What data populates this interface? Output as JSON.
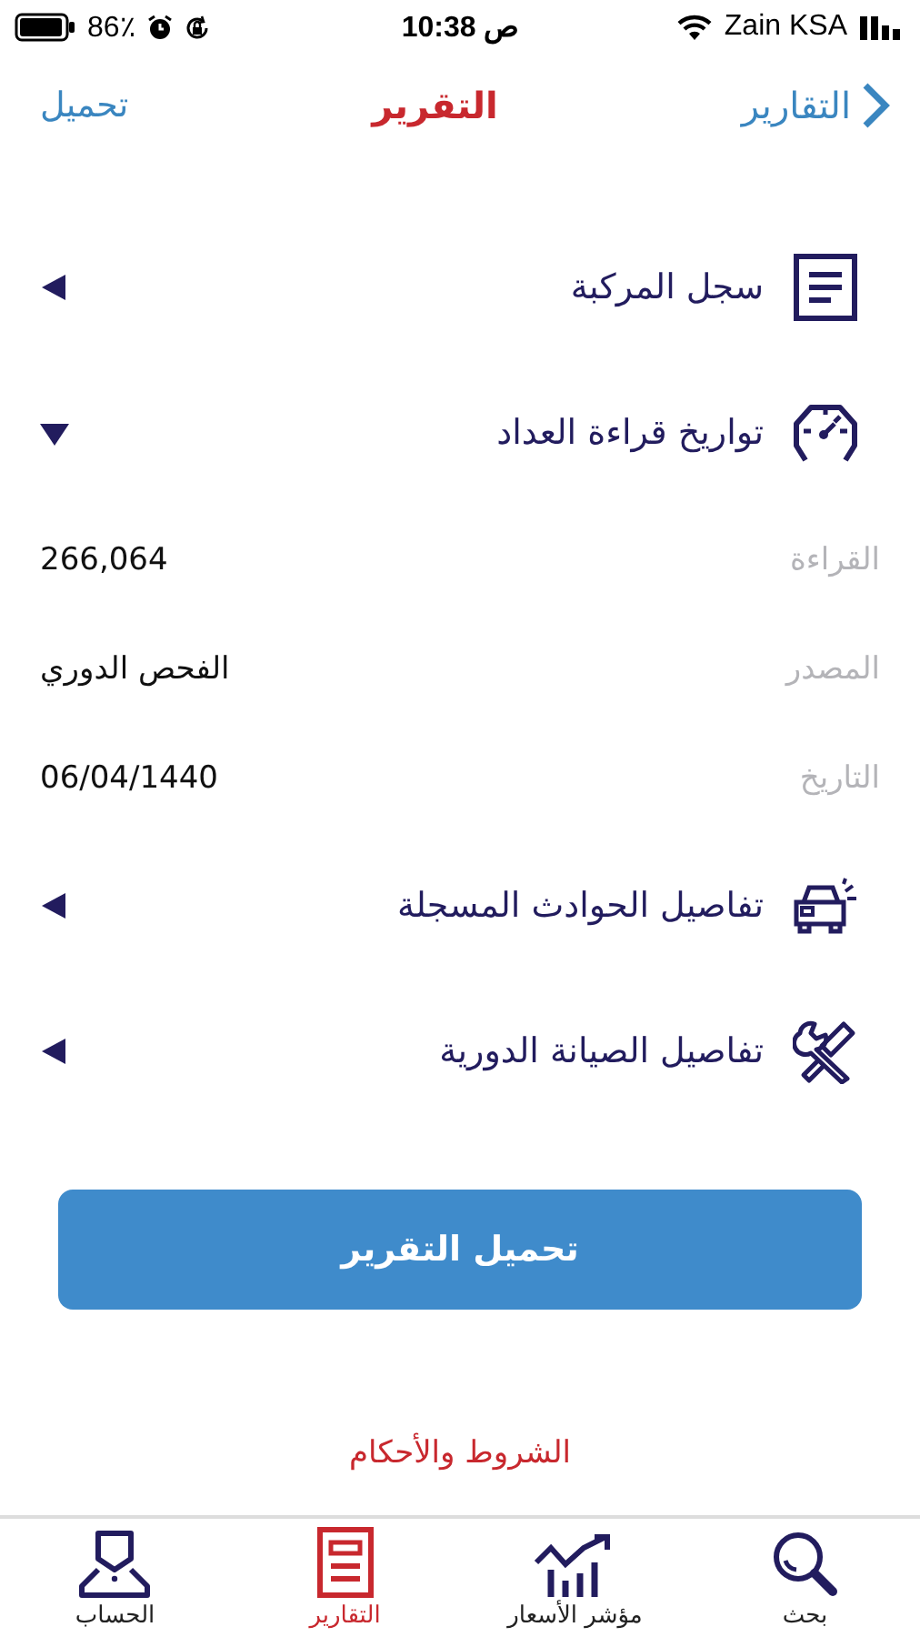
{
  "status_bar": {
    "battery": "86٪",
    "time": "10:38 ص",
    "carrier": "Zain KSA"
  },
  "nav": {
    "back": "التقارير",
    "title": "التقرير",
    "action": "تحميل"
  },
  "sections": [
    {
      "title": "سجل المركبة",
      "expanded": false
    },
    {
      "title": "تواريخ قراءة العداد",
      "expanded": true,
      "details": [
        {
          "label": "القراءة",
          "value": "266,064"
        },
        {
          "label": "المصدر",
          "value": "الفحص الدوري"
        },
        {
          "label": "التاريخ",
          "value": "06/04/1440"
        }
      ]
    },
    {
      "title": "تفاصيل الحوادث المسجلة",
      "expanded": false
    },
    {
      "title": "تفاصيل الصيانة الدورية",
      "expanded": false
    }
  ],
  "download_button": "تحميل التقرير",
  "terms_link": "الشروط والأحكام",
  "tab_bar": [
    {
      "label": "بحث",
      "selected": false
    },
    {
      "label": "مؤشر الأسعار",
      "selected": false
    },
    {
      "label": "التقارير",
      "selected": true
    },
    {
      "label": "الحساب",
      "selected": false
    }
  ]
}
